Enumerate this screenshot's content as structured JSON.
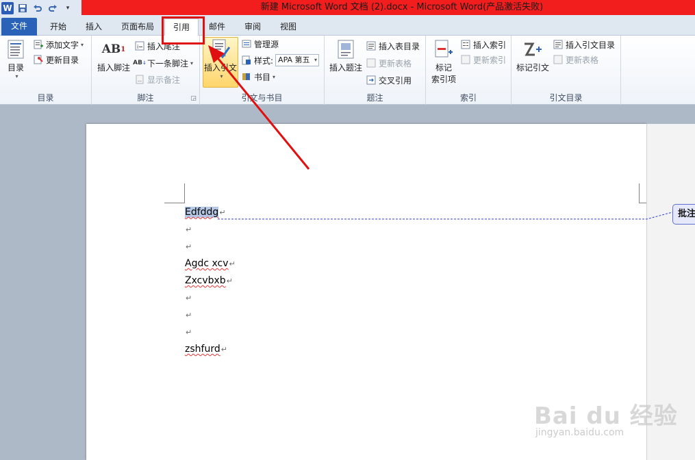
{
  "window": {
    "title": "新建 Microsoft Word 文档 (2).docx  -  Microsoft Word(产品激活失败)"
  },
  "tabs": [
    {
      "label": "文件"
    },
    {
      "label": "开始"
    },
    {
      "label": "插入"
    },
    {
      "label": "页面布局"
    },
    {
      "label": "引用"
    },
    {
      "label": "邮件"
    },
    {
      "label": "审阅"
    },
    {
      "label": "视图"
    }
  ],
  "ribbon": {
    "toc": {
      "group": "目录",
      "toc_btn": "目录",
      "add_text": "添加文字",
      "update_toc": "更新目录"
    },
    "footnotes": {
      "group": "脚注",
      "insert_footnote": "插入脚注",
      "insert_endnote": "插入尾注",
      "next_footnote": "下一条脚注",
      "show_notes": "显示备注"
    },
    "citations": {
      "group": "引文与书目",
      "insert_citation": "插入引文",
      "manage_sources": "管理源",
      "style_label": "样式:",
      "style_value": "APA 第五",
      "bibliography": "书目"
    },
    "captions": {
      "group": "题注",
      "insert_caption": "插入题注",
      "insert_table_of_figures": "插入表目录",
      "update_table": "更新表格",
      "cross_reference": "交叉引用"
    },
    "index": {
      "group": "索引",
      "mark_entry_1": "标记",
      "mark_entry_2": "索引项",
      "insert_index": "插入索引",
      "update_index": "更新索引"
    },
    "toa": {
      "group": "引文目录",
      "mark_citation": "标记引文",
      "insert_toa": "插入引文目录",
      "update_table": "更新表格"
    }
  },
  "document": {
    "lines": [
      "Edfddg",
      "",
      "",
      "Agdc xcv",
      "Zxcvbxb",
      "",
      "",
      "",
      "zshfurd"
    ],
    "comment_label": "批注"
  },
  "watermark": {
    "brand": "Bai du 经验",
    "url": "jingyan.baidu.com"
  },
  "colors": {
    "accent": "#2a62b8",
    "title_bar_highlight": "#f21d1d",
    "annotation": "#e01010"
  }
}
